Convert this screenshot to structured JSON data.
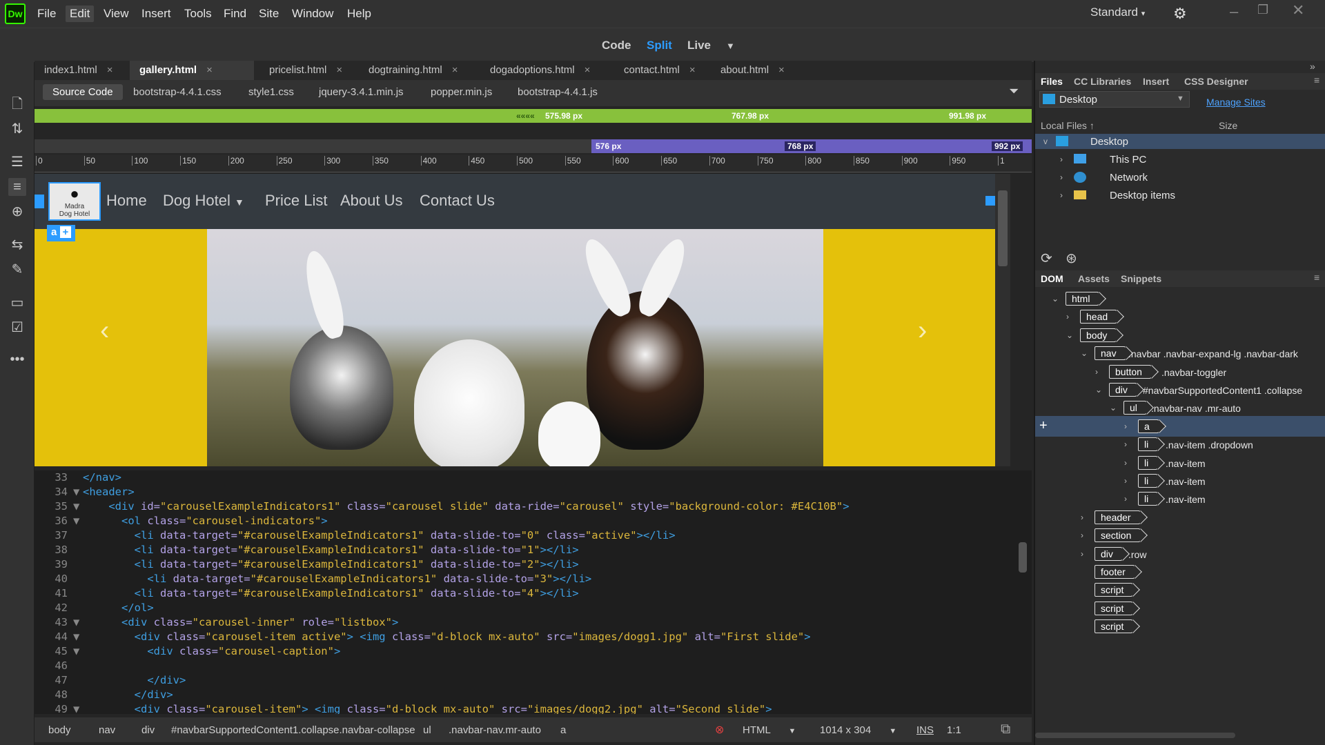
{
  "app": {
    "logo": "Dw",
    "menus": [
      "File",
      "Edit",
      "View",
      "Insert",
      "Tools",
      "Find",
      "Site",
      "Window",
      "Help"
    ],
    "workspace": "Standard"
  },
  "viewmodes": {
    "code": "Code",
    "split": "Split",
    "live": "Live"
  },
  "doc_tabs": [
    "index1.html",
    "gallery.html",
    "pricelist.html",
    "dogtraining.html",
    "dogadoptions.html",
    "contact.html",
    "about.html"
  ],
  "related_files": [
    "Source Code",
    "bootstrap-4.4.1.css",
    "style1.css",
    "jquery-3.4.1.min.js",
    "popper.min.js",
    "bootstrap-4.4.1.js"
  ],
  "media_queries": {
    "max": [
      "575.98",
      "767.98",
      "991.98"
    ],
    "min": [
      "576",
      "768",
      "992"
    ],
    "unit": "px"
  },
  "ruler_ticks": [
    "0",
    "50",
    "100",
    "150",
    "200",
    "250",
    "300",
    "350",
    "400",
    "450",
    "500",
    "550",
    "600",
    "650",
    "700",
    "750",
    "800",
    "850",
    "900",
    "950",
    "1"
  ],
  "live_view": {
    "logo_text": [
      "Madra",
      "Dog Hotel"
    ],
    "nav_links": [
      "Home",
      "Dog Hotel",
      "Price List",
      "About Us",
      "Contact Us"
    ],
    "selected_tag": "a",
    "add_symbol": "+",
    "carousel_bg": "#E4C10B",
    "prev_arrow": "‹",
    "next_arrow": "›"
  },
  "code_lines": [
    {
      "n": "33",
      "fold": "",
      "indent": 0,
      "html": [
        [
          "tag",
          "</nav>"
        ]
      ]
    },
    {
      "n": "34",
      "fold": "▼",
      "indent": 0,
      "html": [
        [
          "tag",
          "<header>"
        ]
      ]
    },
    {
      "n": "35",
      "fold": "▼",
      "indent": 2,
      "html": [
        [
          "tag",
          "<div "
        ],
        [
          "attr",
          "id="
        ],
        [
          "str",
          "\"carouselExampleIndicators1\""
        ],
        [
          "attr",
          " class="
        ],
        [
          "str",
          "\"carousel slide\""
        ],
        [
          "attr",
          " data-ride="
        ],
        [
          "str",
          "\"carousel\""
        ],
        [
          "attr",
          " style="
        ],
        [
          "str",
          "\"background-color: #E4C10B\""
        ],
        [
          "tag",
          ">"
        ]
      ]
    },
    {
      "n": "36",
      "fold": "▼",
      "indent": 3,
      "html": [
        [
          "tag",
          "<ol "
        ],
        [
          "attr",
          "class="
        ],
        [
          "str",
          "\"carousel-indicators\""
        ],
        [
          "tag",
          ">"
        ]
      ]
    },
    {
      "n": "37",
      "fold": "",
      "indent": 4,
      "html": [
        [
          "tag",
          "<li "
        ],
        [
          "attr",
          "data-target="
        ],
        [
          "str",
          "\"#carouselExampleIndicators1\""
        ],
        [
          "attr",
          " data-slide-to="
        ],
        [
          "str",
          "\"0\""
        ],
        [
          "attr",
          " class="
        ],
        [
          "str",
          "\"active\""
        ],
        [
          "tag",
          "></li>"
        ]
      ]
    },
    {
      "n": "38",
      "fold": "",
      "indent": 4,
      "html": [
        [
          "tag",
          "<li "
        ],
        [
          "attr",
          "data-target="
        ],
        [
          "str",
          "\"#carouselExampleIndicators1\""
        ],
        [
          "attr",
          " data-slide-to="
        ],
        [
          "str",
          "\"1\""
        ],
        [
          "tag",
          "></li>"
        ]
      ]
    },
    {
      "n": "39",
      "fold": "",
      "indent": 4,
      "html": [
        [
          "tag",
          "<li "
        ],
        [
          "attr",
          "data-target="
        ],
        [
          "str",
          "\"#carouselExampleIndicators1\""
        ],
        [
          "attr",
          " data-slide-to="
        ],
        [
          "str",
          "\"2\""
        ],
        [
          "tag",
          "></li>"
        ]
      ]
    },
    {
      "n": "40",
      "fold": "",
      "indent": 5,
      "html": [
        [
          "tag",
          "<li "
        ],
        [
          "attr",
          "data-target="
        ],
        [
          "str",
          "\"#carouselExampleIndicators1\""
        ],
        [
          "attr",
          " data-slide-to="
        ],
        [
          "str",
          "\"3\""
        ],
        [
          "tag",
          "></li>"
        ]
      ]
    },
    {
      "n": "41",
      "fold": "",
      "indent": 4,
      "html": [
        [
          "tag",
          "<li "
        ],
        [
          "attr",
          "data-target="
        ],
        [
          "str",
          "\"#carouselExampleIndicators1\""
        ],
        [
          "attr",
          " data-slide-to="
        ],
        [
          "str",
          "\"4\""
        ],
        [
          "tag",
          "></li>"
        ]
      ]
    },
    {
      "n": "42",
      "fold": "",
      "indent": 3,
      "html": [
        [
          "tag",
          "</ol>"
        ]
      ]
    },
    {
      "n": "43",
      "fold": "▼",
      "indent": 3,
      "html": [
        [
          "tag",
          "<div "
        ],
        [
          "attr",
          "class="
        ],
        [
          "str",
          "\"carousel-inner\""
        ],
        [
          "attr",
          " role="
        ],
        [
          "str",
          "\"listbox\""
        ],
        [
          "tag",
          ">"
        ]
      ]
    },
    {
      "n": "44",
      "fold": "▼",
      "indent": 4,
      "html": [
        [
          "tag",
          "<div "
        ],
        [
          "attr",
          "class="
        ],
        [
          "str",
          "\"carousel-item active\""
        ],
        [
          "tag",
          "> <img "
        ],
        [
          "attr",
          "class="
        ],
        [
          "str",
          "\"d-block mx-auto\""
        ],
        [
          "attr",
          " src="
        ],
        [
          "str",
          "\"images/dogg1.jpg\""
        ],
        [
          "attr",
          " alt="
        ],
        [
          "str",
          "\"First slide\""
        ],
        [
          "tag",
          ">"
        ]
      ]
    },
    {
      "n": "45",
      "fold": "▼",
      "indent": 5,
      "html": [
        [
          "tag",
          "<div "
        ],
        [
          "attr",
          "class="
        ],
        [
          "str",
          "\"carousel-caption\""
        ],
        [
          "tag",
          ">"
        ]
      ]
    },
    {
      "n": "46",
      "fold": "",
      "indent": 0,
      "html": []
    },
    {
      "n": "47",
      "fold": "",
      "indent": 5,
      "html": [
        [
          "tag",
          "</div>"
        ]
      ]
    },
    {
      "n": "48",
      "fold": "",
      "indent": 4,
      "html": [
        [
          "tag",
          "</div>"
        ]
      ]
    },
    {
      "n": "49",
      "fold": "▼",
      "indent": 4,
      "html": [
        [
          "tag",
          "<div "
        ],
        [
          "attr",
          "class="
        ],
        [
          "str",
          "\"carousel-item\""
        ],
        [
          "tag",
          "> <img "
        ],
        [
          "attr",
          "class="
        ],
        [
          "str",
          "\"d-block mx-auto\""
        ],
        [
          "attr",
          " src="
        ],
        [
          "str",
          "\"images/dogg2.jpg\""
        ],
        [
          "attr",
          " alt="
        ],
        [
          "str",
          "\"Second slide\""
        ],
        [
          "tag",
          ">"
        ]
      ]
    }
  ],
  "statusbar": {
    "crumbs": [
      "body",
      "nav",
      "div",
      "#navbarSupportedContent1.collapse.navbar-collapse",
      "ul",
      ".navbar-nav.mr-auto",
      "a"
    ],
    "language": "HTML",
    "size": "1014 x 304",
    "mode": "INS",
    "ratio": "1:1"
  },
  "files_panel": {
    "tabs": [
      "Files",
      "CC Libraries",
      "Insert",
      "CSS Designer"
    ],
    "site": "Desktop",
    "manage": "Manage Sites",
    "local_files": "Local Files",
    "size_col": "Size",
    "root": "Desktop",
    "children": [
      "This PC",
      "Network",
      "Desktop items"
    ]
  },
  "dom_panel": {
    "tabs": [
      "DOM",
      "Assets",
      "Snippets"
    ],
    "rows": [
      {
        "tag": "html",
        "cls": "",
        "depth": 0,
        "chev": "v"
      },
      {
        "tag": "head",
        "cls": "",
        "depth": 1,
        "chev": ">"
      },
      {
        "tag": "body",
        "cls": "",
        "depth": 1,
        "chev": "v"
      },
      {
        "tag": "nav",
        "cls": ".navbar .navbar-expand-lg .navbar-dark",
        "depth": 2,
        "chev": "v"
      },
      {
        "tag": "button",
        "cls": ".navbar-toggler",
        "depth": 3,
        "chev": ">"
      },
      {
        "tag": "div",
        "cls": "#navbarSupportedContent1 .collapse",
        "depth": 3,
        "chev": "v"
      },
      {
        "tag": "ul",
        "cls": ".navbar-nav .mr-auto",
        "depth": 4,
        "chev": "v"
      },
      {
        "tag": "a",
        "cls": "",
        "depth": 5,
        "chev": ">",
        "selected": true
      },
      {
        "tag": "li",
        "cls": ".nav-item .dropdown",
        "depth": 5,
        "chev": ">"
      },
      {
        "tag": "li",
        "cls": ".nav-item",
        "depth": 5,
        "chev": ">"
      },
      {
        "tag": "li",
        "cls": ".nav-item",
        "depth": 5,
        "chev": ">"
      },
      {
        "tag": "li",
        "cls": ".nav-item",
        "depth": 5,
        "chev": ">"
      },
      {
        "tag": "header",
        "cls": "",
        "depth": 2,
        "chev": ">"
      },
      {
        "tag": "section",
        "cls": "",
        "depth": 2,
        "chev": ">"
      },
      {
        "tag": "div",
        "cls": ".row",
        "depth": 2,
        "chev": ">"
      },
      {
        "tag": "footer",
        "cls": "",
        "depth": 2,
        "chev": ""
      },
      {
        "tag": "script",
        "cls": "",
        "depth": 2,
        "chev": ""
      },
      {
        "tag": "script",
        "cls": "",
        "depth": 2,
        "chev": ""
      },
      {
        "tag": "script",
        "cls": "",
        "depth": 2,
        "chev": ""
      }
    ]
  }
}
